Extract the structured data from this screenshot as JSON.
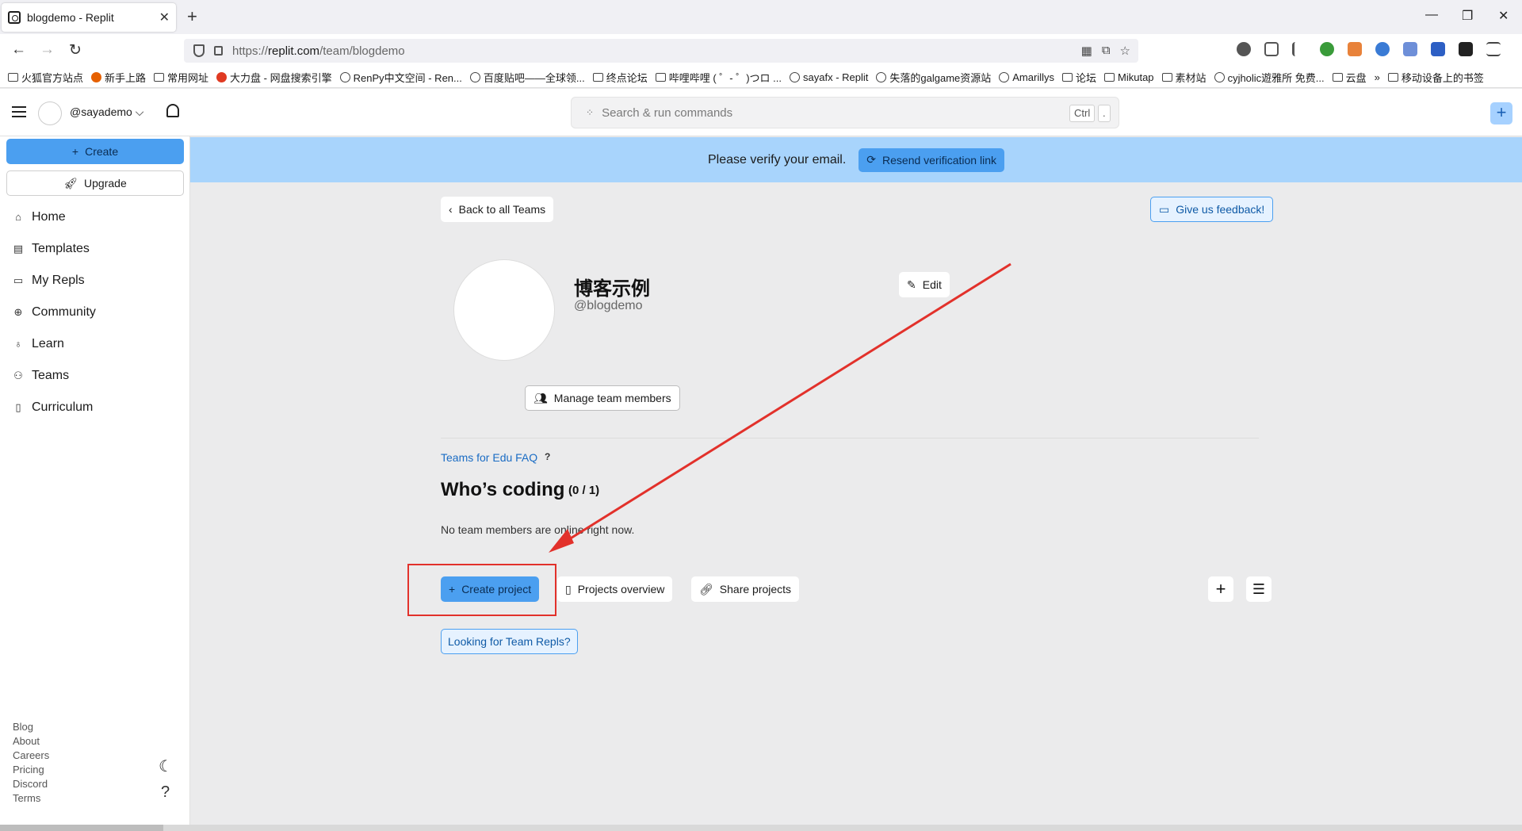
{
  "browser": {
    "tab_title": "blogdemo - Replit",
    "tab_close": "✕",
    "new_tab": "+",
    "url_proto": "https://",
    "url_host": "replit.com",
    "url_path": "/team/blogdemo",
    "window_controls": [
      "—",
      "❐",
      "✕"
    ],
    "bookmarks": [
      {
        "label": "火狐官方站点",
        "icon": "folder-icon"
      },
      {
        "label": "新手上路",
        "icon": "firefox-icon"
      },
      {
        "label": "常用网址",
        "icon": "folder-icon"
      },
      {
        "label": "大力盘 - 网盘搜索引擎",
        "icon": "red-icon"
      },
      {
        "label": "RenPy中文空间 - Ren...",
        "icon": "globe-icon"
      },
      {
        "label": "百度贴吧——全球领...",
        "icon": "globe-icon"
      },
      {
        "label": "终点论坛",
        "icon": "image-icon"
      },
      {
        "label": "哔哩哔哩 ( ゜- ゜)つロ ...",
        "icon": "bilibili-icon"
      },
      {
        "label": "sayafx - Replit",
        "icon": "globe-icon"
      },
      {
        "label": "失落的galgame资源站",
        "icon": "globe-icon"
      },
      {
        "label": "Amarillys",
        "icon": "globe-icon"
      },
      {
        "label": "论坛",
        "icon": "folder-icon"
      },
      {
        "label": "Mikutap",
        "icon": "image-icon"
      },
      {
        "label": "素材站",
        "icon": "folder-icon"
      },
      {
        "label": "cyjholic遊雅所 免费...",
        "icon": "globe-icon"
      },
      {
        "label": "云盘",
        "icon": "folder-icon"
      },
      {
        "label": "»",
        "icon": "more-icon"
      },
      {
        "label": "移动设备上的书签",
        "icon": "mobile-icon"
      }
    ]
  },
  "app": {
    "username": "@sayademo",
    "search_placeholder": "Search & run commands",
    "kbd_ctrl": "Ctrl",
    "kbd_dot": ".",
    "sidebar": {
      "create_label": "Create",
      "upgrade_label": "Upgrade",
      "items": [
        {
          "label": "Home",
          "icon": "home-icon"
        },
        {
          "label": "Templates",
          "icon": "templates-icon"
        },
        {
          "label": "My Repls",
          "icon": "folder-icon"
        },
        {
          "label": "Community",
          "icon": "globe-icon"
        },
        {
          "label": "Learn",
          "icon": "learn-icon"
        },
        {
          "label": "Teams",
          "icon": "teams-icon"
        },
        {
          "label": "Curriculum",
          "icon": "book-icon"
        }
      ],
      "footer": [
        "Blog",
        "About",
        "Careers",
        "Pricing",
        "Discord",
        "Terms"
      ]
    },
    "banner": {
      "text": "Please verify your email.",
      "button": "Resend verification link"
    },
    "team": {
      "back_label": "Back to all Teams",
      "feedback_label": "Give us feedback!",
      "name": "博客示例",
      "handle": "@blogdemo",
      "edit_label": "Edit",
      "manage_label": "Manage team members",
      "faq_label": "Teams for Edu FAQ",
      "faq_q": "?",
      "coding_title": "Who’s coding",
      "coding_count": "(0 / 1)",
      "no_members": "No team members are online right now.",
      "create_project": "Create project",
      "projects_overview": "Projects overview",
      "share_projects": "Share projects",
      "team_repls": "Looking for Team Repls?"
    }
  },
  "colors": {
    "accent": "#4b9ff0",
    "banner": "#a8d4fc",
    "annotation": "#e2312b"
  }
}
